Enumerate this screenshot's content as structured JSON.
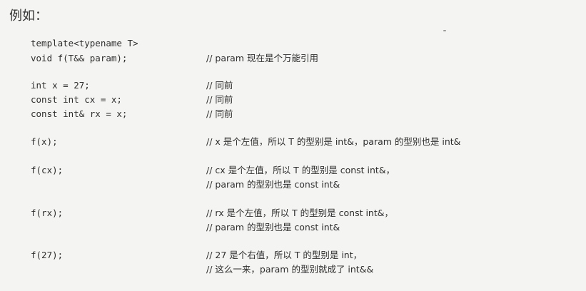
{
  "heading": "例如：",
  "lines": [
    {
      "code": "template<typename T>",
      "comment": ""
    },
    {
      "code": "void f(T&& param);",
      "comment": "// param 现在是个万能引用"
    },
    {
      "code": "int x = 27;",
      "comment": "// 同前"
    },
    {
      "code": "const int cx = x;",
      "comment": "// 同前"
    },
    {
      "code": "const int& rx = x;",
      "comment": "// 同前"
    },
    {
      "code": "f(x);",
      "comment": "// x 是个左值，所以 T 的型别是 int&，param 的型别也是 int&"
    },
    {
      "code": "f(cx);",
      "comment": "// cx 是个左值，所以 T 的型别是 const int&，"
    },
    {
      "code": "",
      "comment": "// param 的型别也是 const int&"
    },
    {
      "code": "f(rx);",
      "comment": "// rx 是个左值，所以 T 的型别是 const int&，"
    },
    {
      "code": "",
      "comment": "// param 的型别也是 const int&"
    },
    {
      "code": "f(27);",
      "comment": "// 27 是个右值，所以 T 的型别是 int，"
    },
    {
      "code": "",
      "comment": "// 这么一来，param 的型别就成了 int&&"
    }
  ]
}
